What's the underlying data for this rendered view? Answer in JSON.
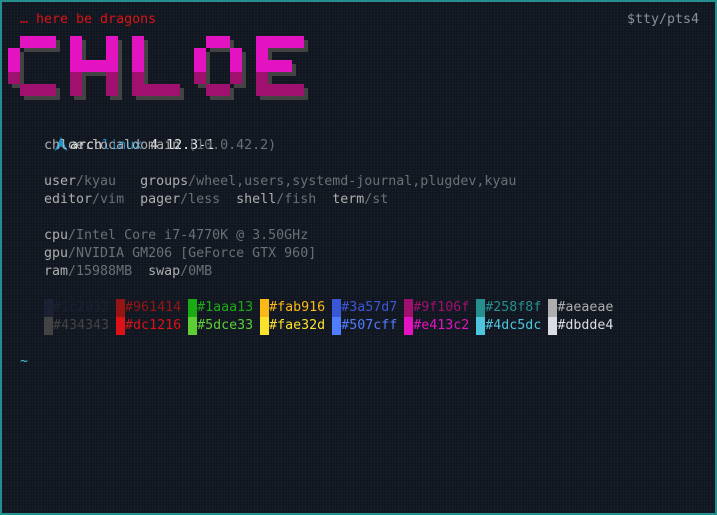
{
  "header": {
    "tagline": "… here be dragons",
    "tty": "$tty/pts4"
  },
  "logo": {
    "text": "CHLOE",
    "colors": {
      "primary": "#e413c2",
      "dark": "#9f106f",
      "shadow": "#434343"
    }
  },
  "system": {
    "distro_prefix": "arch",
    "distro_suffix": "linux",
    "kernel": "4.12.3-1",
    "hostname": "chloe.localdomain",
    "ip": "(10.0.42.2)"
  },
  "user": {
    "user_key": "user",
    "user_val": "/kyau",
    "groups_key": "groups",
    "groups_val": "/wheel,users,systemd-journal,plugdev,kyau",
    "editor_key": "editor",
    "editor_val": "/vim",
    "pager_key": "pager",
    "pager_val": "/less",
    "shell_key": "shell",
    "shell_val": "/fish",
    "term_key": "term",
    "term_val": "/st"
  },
  "hardware": {
    "cpu_key": "cpu",
    "cpu_val": "/Intel Core i7-4770K @ 3.50GHz",
    "gpu_key": "gpu",
    "gpu_val": "/NVIDIA GM206 [GeForce GTX 960]",
    "ram_key": "ram",
    "ram_val": "/15988MB",
    "swap_key": "swap",
    "swap_val": "/0MB"
  },
  "palette": {
    "normal": [
      "#1c2032",
      "#961414",
      "#1aaa13",
      "#fab916",
      "#3a57d7",
      "#9f106f",
      "#258f8f",
      "#aeaeae"
    ],
    "bright": [
      "#434343",
      "#dc1216",
      "#5dce33",
      "#fae32d",
      "#507cff",
      "#e413c2",
      "#4dc5dc",
      "#dbdde4"
    ]
  },
  "prompt": {
    "symbol": "~"
  }
}
